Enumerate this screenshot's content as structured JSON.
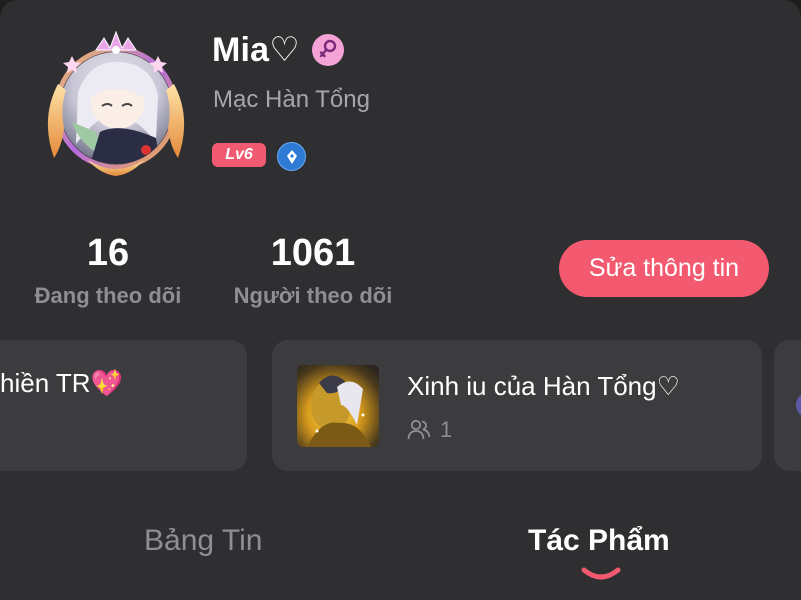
{
  "profile": {
    "username": "Mia♡",
    "subname": "Mạc Hàn Tổng",
    "level": "Lv6",
    "gender_icon": "female-symbol-icon",
    "badge_icon": "pen-badge-icon"
  },
  "stats": {
    "following_count": "16",
    "following_label": "Đang theo dõi",
    "followers_count": "1061",
    "followers_label": "Người theo dõi"
  },
  "edit_button_label": "Sửa thông tin",
  "groups": [
    {
      "title": "hiền TR💖"
    },
    {
      "title": "Xinh iu của Hàn Tổng♡",
      "members": "1"
    }
  ],
  "tabs": [
    {
      "label": "Bảng Tin",
      "active": false
    },
    {
      "label": "Tác Phẩm",
      "active": true
    }
  ],
  "colors": {
    "accent": "#f35a6f",
    "background": "#2f2f31",
    "card": "#3c3c3f",
    "muted_text": "#8e8e93"
  }
}
